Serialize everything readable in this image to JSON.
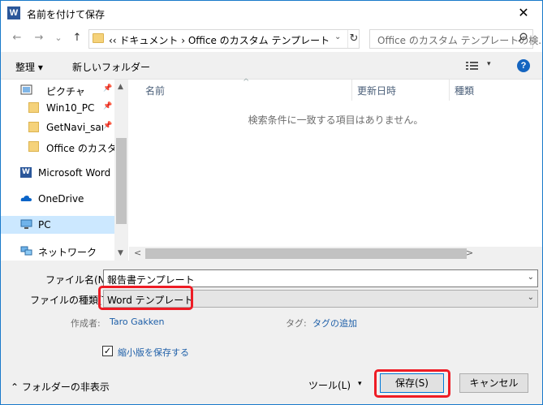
{
  "window": {
    "app_icon": "W",
    "title": "名前を付けて保存",
    "close_icon": "✕"
  },
  "nav": {
    "back_icon": "←",
    "forward_icon": "→",
    "recent_icon": "⌄",
    "up_icon": "↑",
    "address": "‹‹  ドキュメント  ›  Office のカスタム テンプレート",
    "address_dropdown": "⌄",
    "refresh_icon": "↻",
    "search_placeholder": "Office のカスタム テンプレートの検..."
  },
  "toolbar": {
    "organize_label": "整理 ▾",
    "new_folder_label": "新しいフォルダー",
    "view_dropdown": "▾",
    "help": "?"
  },
  "navpane": {
    "items": [
      {
        "label": "ピクチャ"
      },
      {
        "label": "Win10_PC"
      },
      {
        "label": "GetNavi_samp"
      },
      {
        "label": "Office のカスタム テ"
      },
      {
        "label": "Microsoft Word"
      },
      {
        "label": "OneDrive"
      },
      {
        "label": "PC"
      },
      {
        "label": "ネットワーク"
      }
    ],
    "pin_icon": "📌",
    "scroll_up": "▲",
    "scroll_down": "▼"
  },
  "filelist": {
    "columns": [
      "名前",
      "更新日時",
      "種類"
    ],
    "sort_indicator": "^",
    "empty_message": "検索条件に一致する項目はありません。",
    "scroll_left": "<",
    "scroll_right": ">"
  },
  "form": {
    "filename_label": "ファイル名(N):",
    "filename_value": "報告書テンプレート",
    "filetype_label": "ファイルの種類(T):",
    "filetype_value": "Word テンプレート",
    "dropdown_icon": "⌄",
    "author_label": "作成者:",
    "author_value": "Taro Gakken",
    "tags_label": "タグ:",
    "tags_value": "タグの追加",
    "thumbnail_checked": "✓",
    "thumbnail_label": "縮小版を保存する",
    "hide_folders_label": "⌃  フォルダーの非表示",
    "tools_label": "ツール(L)",
    "tools_dropdown": "▾",
    "save_label": "保存(S)",
    "cancel_label": "キャンセル"
  },
  "colors": {
    "highlight_ring": "#ee1c25",
    "accent": "#0078d7",
    "link": "#1e5fa8",
    "selection": "#cce8ff"
  }
}
